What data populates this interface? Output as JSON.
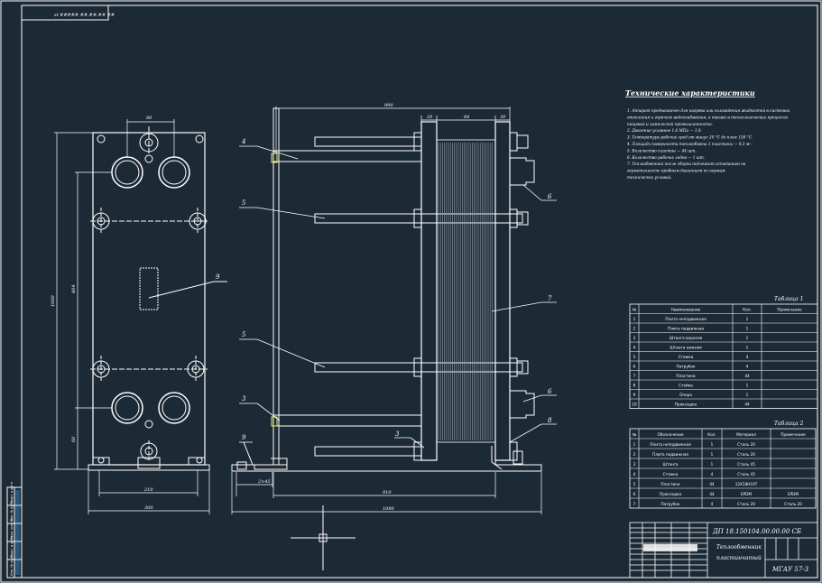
{
  "colors": {
    "background": "#1c2a35",
    "line": "#ffffff",
    "dim": "#3fa9f5",
    "yellow": "#f0f060"
  },
  "frame_stamp": "st ##### ##.##.## ##",
  "front_view": {
    "dim_top": "80",
    "dim_total_height": "1000",
    "dim_inner_height": "804",
    "dim_lower": "60",
    "dim_width_inner": "210",
    "dim_width_outer": "300",
    "leader_9": "9"
  },
  "side_view": {
    "dim_overall_top": "990",
    "dim_top_a": "20",
    "dim_top_b": "84",
    "dim_top_c": "30",
    "dim_bottom_inner": "910",
    "dim_bottom_outer": "1080",
    "dim_foot": "2×45",
    "labels": [
      "4",
      "5",
      "5",
      "3",
      "9",
      "6",
      "7",
      "6",
      "8",
      "3"
    ]
  },
  "tech_req": {
    "heading": "Технические характеристики",
    "lines": [
      "1. Аппарат предназначен для нагрева или охлаждения жидкостей в системах",
      "   отопления и горячего водоснабжения, а также в технологических процессах",
      "   пищевой и химической промышленности.",
      "2. Давление условное 1,6 МПа — 1,0.",
      "3. Температура рабочих сред от минус 20 °С до плюс 150 °С.",
      "4. Площадь поверхности теплообмена 1 пластины — 0,3 м².",
      "5. Количество пластин — 44 шт.",
      "6. Количество рабочих ходов — 1 шт.",
      "7. Теплообменник после сборки подлежит испытанию на",
      "   герметичность пробным давлением по нормам",
      "   технических условий."
    ]
  },
  "table1": {
    "title": "Таблица 1",
    "head": [
      "№",
      "Наименование",
      "Кол.",
      "Примечание"
    ],
    "rows": [
      [
        "1",
        "Плита неподвижная",
        "1",
        ""
      ],
      [
        "2",
        "Плита подвижная",
        "1",
        ""
      ],
      [
        "3",
        "Штанга верхняя",
        "1",
        ""
      ],
      [
        "4",
        "Штанга нижняя",
        "1",
        ""
      ],
      [
        "5",
        "Стяжка",
        "4",
        ""
      ],
      [
        "6",
        "Патрубок",
        "4",
        ""
      ],
      [
        "7",
        "Пластина",
        "44",
        ""
      ],
      [
        "8",
        "Стойка",
        "1",
        ""
      ],
      [
        "9",
        "Опора",
        "1",
        ""
      ],
      [
        "10",
        "Прокладка",
        "44",
        ""
      ]
    ]
  },
  "table2": {
    "title": "Таблица 2",
    "head": [
      "№",
      "Обозначение",
      "Кол.",
      "Материал",
      "Примечание"
    ],
    "rows": [
      [
        "1",
        "Плита неподвижная",
        "1",
        "Сталь 20",
        ""
      ],
      [
        "2",
        "Плита подвижная",
        "1",
        "Сталь 20",
        ""
      ],
      [
        "3",
        "Штанга",
        "1",
        "Сталь 45",
        ""
      ],
      [
        "4",
        "Стяжка",
        "4",
        "Сталь 45",
        ""
      ],
      [
        "5",
        "Пластина",
        "44",
        "12Х18Н10Т",
        ""
      ],
      [
        "6",
        "Прокладка",
        "44",
        "EPDM",
        "EPDM"
      ],
      [
        "7",
        "Патрубок",
        "4",
        "Сталь 20",
        "Сталь 20"
      ]
    ]
  },
  "title_block": {
    "designation": "ДП 18.150104.00.00.00 СБ",
    "name_line1": "Теплообменник",
    "name_line2": "пластинчатый",
    "org": "МГАУ 57-3"
  },
  "side_stamp": [
    "Инв. № подл.",
    "Подп. и дата",
    "Взам. инв. №",
    "Инв. № дубл.",
    "Подп. и дата"
  ]
}
